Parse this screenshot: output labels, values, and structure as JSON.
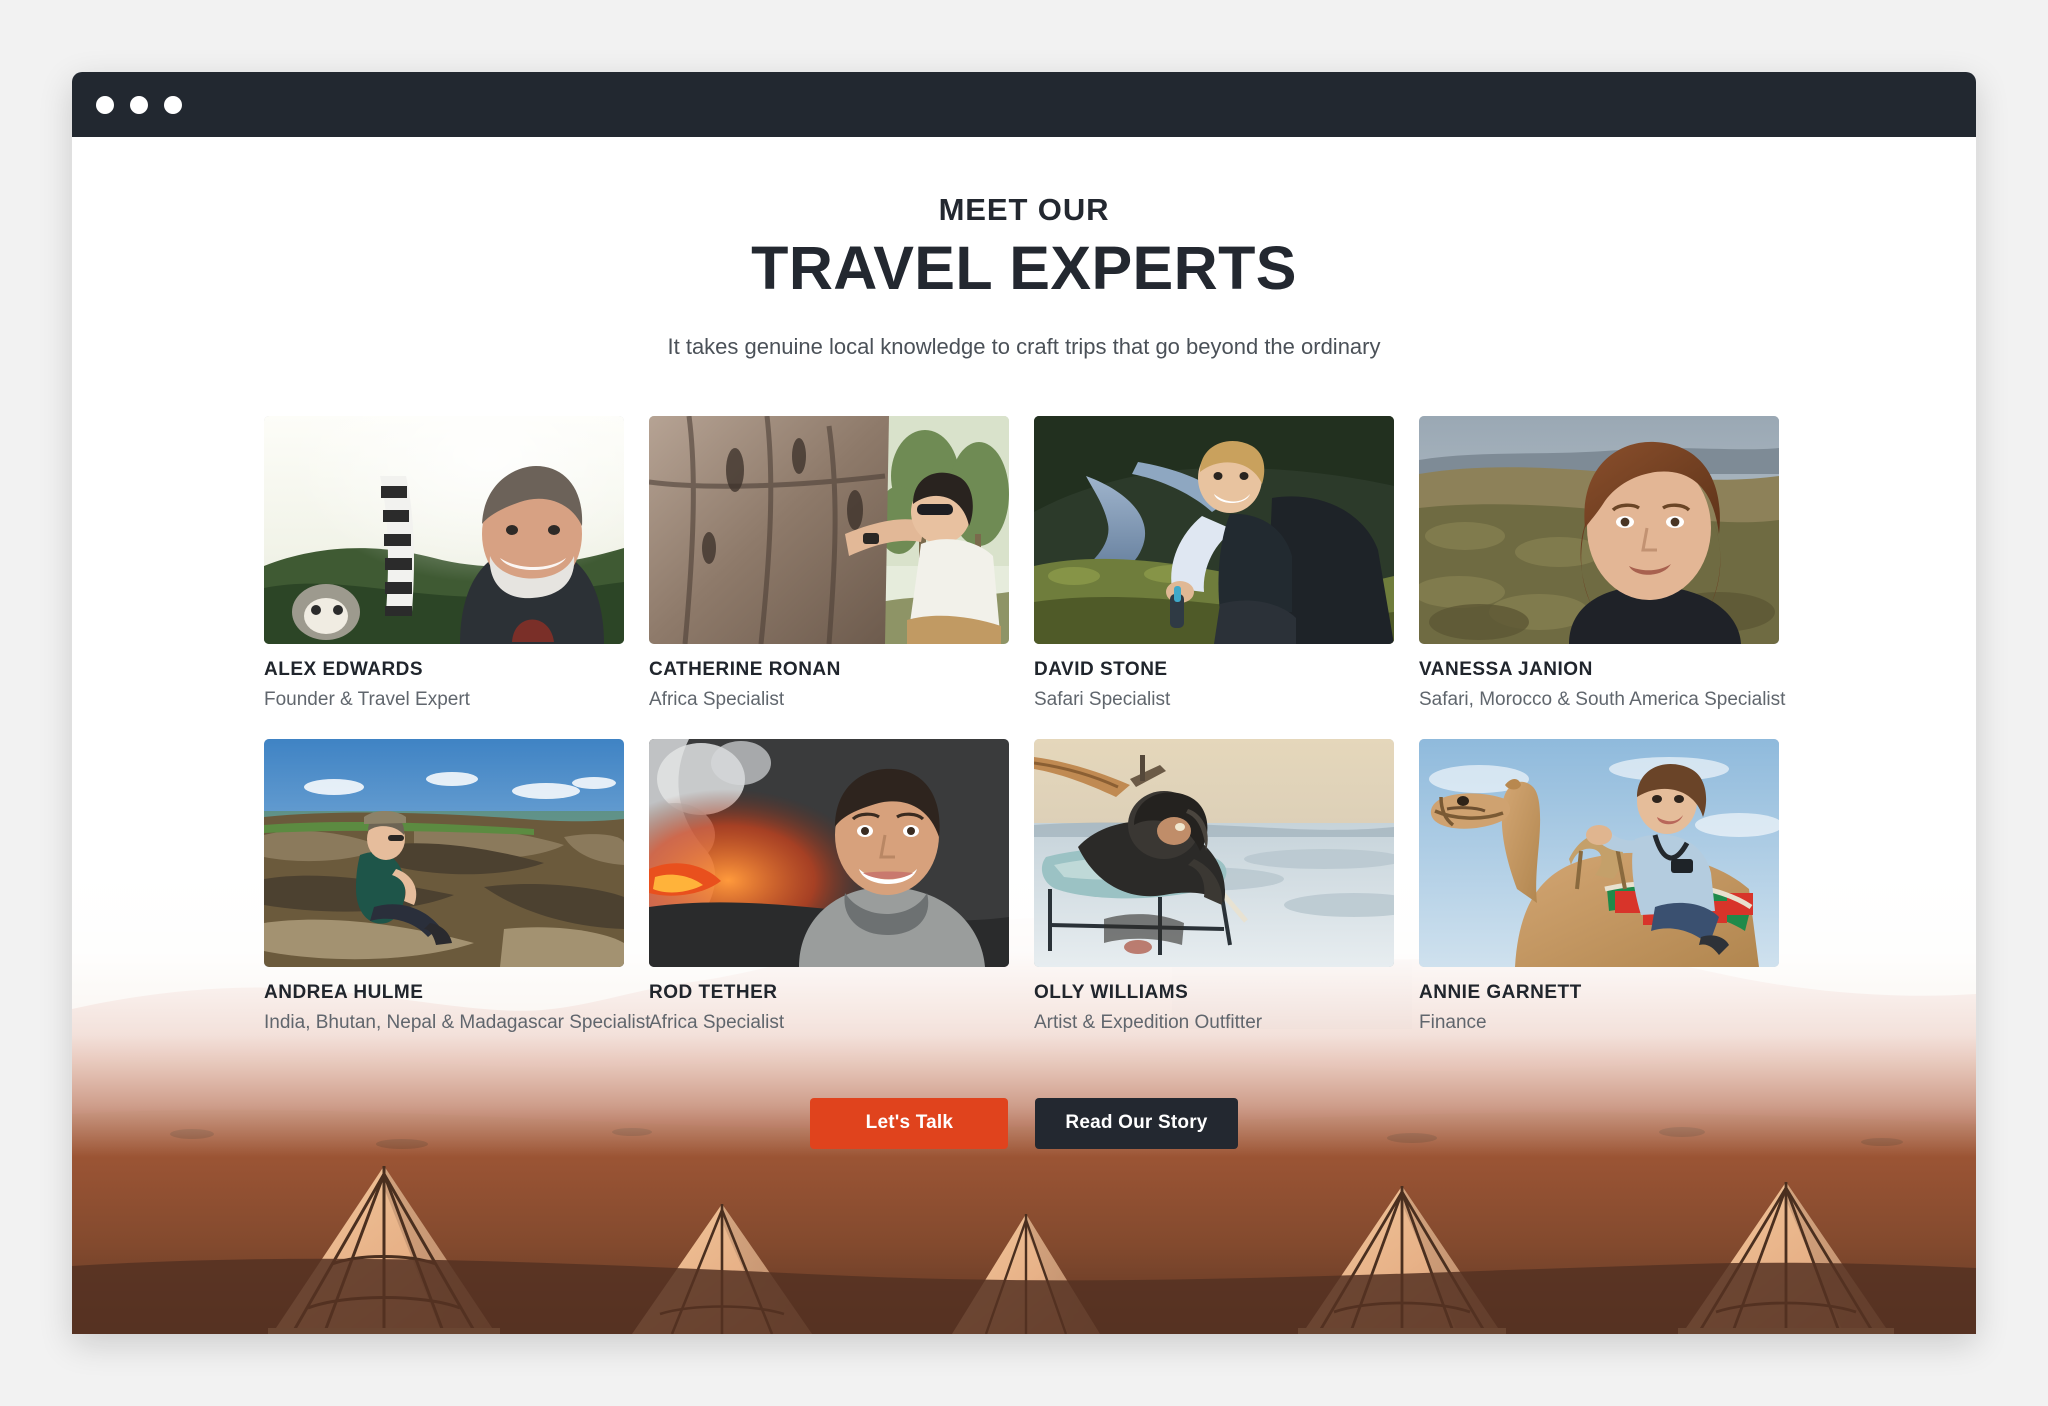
{
  "window": {
    "dots": [
      "window-dot-1",
      "window-dot-2",
      "window-dot-3"
    ],
    "titlebar_color": "#222830"
  },
  "header": {
    "eyebrow": "MEET OUR",
    "title": "TRAVEL EXPERTS",
    "subtitle": "It takes genuine local knowledge to craft trips that go beyond the ordinary"
  },
  "experts": [
    {
      "name": "ALEX EDWARDS",
      "role": "Founder & Travel Expert",
      "photo": "man-with-lemur-photo"
    },
    {
      "name": "CATHERINE RONAN",
      "role": "Africa Specialist",
      "photo": "woman-at-rock-face-photo"
    },
    {
      "name": "DAVID STONE",
      "role": "Safari Specialist",
      "photo": "man-on-hillside-river-photo"
    },
    {
      "name": "VANESSA JANION",
      "role": "Safari, Morocco & South America Specialist",
      "photo": "woman-portrait-savanna-photo"
    },
    {
      "name": "ANDREA HULME",
      "role": "India, Bhutan, Nepal & Madagascar Specialist",
      "photo": "woman-sitting-on-rocks-photo"
    },
    {
      "name": "ROD TETHER",
      "role": "Africa Specialist",
      "photo": "man-at-volcano-photo"
    },
    {
      "name": "OLLY WILLIAMS",
      "role": "Artist & Expedition Outfitter",
      "photo": "polar-expedition-photo"
    },
    {
      "name": "ANNIE GARNETT",
      "role": "Finance",
      "photo": "woman-riding-camel-photo"
    }
  ],
  "cta": {
    "primary_label": "Let's Talk",
    "primary_color": "#e0431d",
    "secondary_label": "Read Our Story",
    "secondary_color": "#232830"
  },
  "hero": {
    "image": "desert-camp-at-sunset-photo"
  }
}
